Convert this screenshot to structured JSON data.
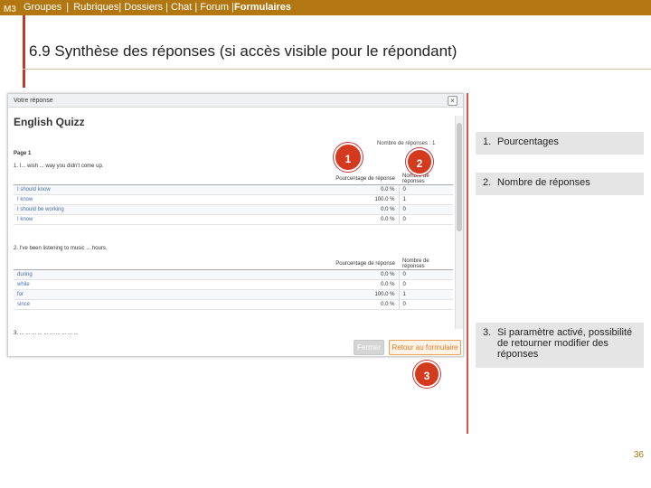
{
  "nav": {
    "badge": "M3",
    "items": [
      "Groupes",
      "Rubriques",
      "Dossiers",
      "Chat",
      "Forum"
    ],
    "separators": [
      " | ",
      "| ",
      " | ",
      " | ",
      " |"
    ],
    "active": "Formulaires"
  },
  "slide": {
    "title": "6.9 Synthèse des réponses (si accès visible pour le répondant)",
    "page_number": "36"
  },
  "window": {
    "title": "Votre réponse",
    "close_glyph": "×",
    "quiz_title": "English Quizz",
    "responses_count": "Nombre de réponses : 1",
    "page_label": "Page 1",
    "questions": [
      {
        "text": "1. I... wish ... way you didn't come up.",
        "col_pct": "Pourcentage de réponse",
        "col_num": "Nombre de réponses",
        "rows": [
          {
            "answer": "I should know",
            "pct": "0.0 %",
            "num": "0"
          },
          {
            "answer": "I know",
            "pct": "100.0 %",
            "num": "1"
          },
          {
            "answer": "I should be working",
            "pct": "0.0 %",
            "num": "0"
          },
          {
            "answer": "I know",
            "pct": "0.0 %",
            "num": "0"
          }
        ]
      },
      {
        "text": "2. I've been listening to music ... hours.",
        "col_pct": "Pourcentage de réponse",
        "col_num": "Nombre de réponses",
        "rows": [
          {
            "answer": "during",
            "pct": "0.0 %",
            "num": "0"
          },
          {
            "answer": "while",
            "pct": "0.0 %",
            "num": "0"
          },
          {
            "answer": "for",
            "pct": "100.0 %",
            "num": "1"
          },
          {
            "answer": "since",
            "pct": "0.0 %",
            "num": "0"
          }
        ]
      }
    ],
    "cut_question": "3. ... ... ... ... ... ... ... ... ... ...",
    "btn_close": "Fermer",
    "btn_return": "Retour au formulaire"
  },
  "markers": [
    "1",
    "2",
    "3"
  ],
  "legend": [
    {
      "num": "1.",
      "text": "Pourcentages"
    },
    {
      "num": "2.",
      "text": "Nombre de réponses"
    },
    {
      "num": "3.",
      "text": "Si paramètre activé, possibilité de retourner modifier des réponses"
    }
  ],
  "colors": {
    "topbar": "#b37712",
    "accent_red": "#d43a1e",
    "legend_bg": "#e5e5e5"
  }
}
